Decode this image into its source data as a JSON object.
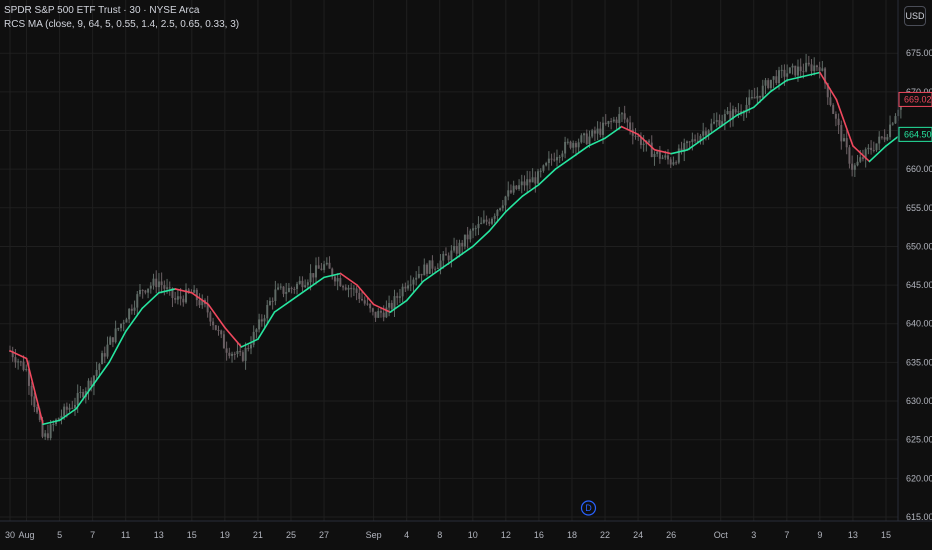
{
  "header": {
    "symbol_line": "SPDR S&P 500 ETF Trust · 30 · NYSE Arca",
    "indicator_line": "RCS MA (close, 9, 64, 5, 0.55, 1.4, 2.5, 0.65, 0.33, 3)"
  },
  "currency": "USD",
  "colors": {
    "background": "#0f0f0f",
    "grid": "#1f1f1f",
    "candle_up": "#5f6b66",
    "candle_down": "#6a5f63",
    "ma_up": "#26e6a0",
    "ma_down": "#f0485e",
    "price_badge_red": "#f0485e",
    "price_badge_green": "#26e6a0",
    "event_marker": "#2962ff"
  },
  "event_marker": {
    "label": "D",
    "date_index": 35
  },
  "chart_data": {
    "type": "line",
    "title": "",
    "xlabel": "",
    "ylabel": "",
    "ylim": [
      615,
      678
    ],
    "y_ticks": [
      615,
      620,
      625,
      630,
      635,
      640,
      645,
      650,
      655,
      660,
      665,
      670,
      675
    ],
    "y_tick_labels": [
      "615.00",
      "620.00",
      "625.00",
      "630.00",
      "635.00",
      "640.00",
      "645.00",
      "650.00",
      "655.00",
      "660.00",
      "665.00",
      "670.00",
      "675.00"
    ],
    "x_tick_labels": [
      {
        "label": "30",
        "i": 0
      },
      {
        "label": "Aug",
        "i": 1
      },
      {
        "label": "5",
        "i": 3
      },
      {
        "label": "7",
        "i": 5
      },
      {
        "label": "11",
        "i": 7
      },
      {
        "label": "13",
        "i": 9
      },
      {
        "label": "15",
        "i": 11
      },
      {
        "label": "19",
        "i": 13
      },
      {
        "label": "21",
        "i": 15
      },
      {
        "label": "25",
        "i": 17
      },
      {
        "label": "27",
        "i": 19
      },
      {
        "label": "Sep",
        "i": 22
      },
      {
        "label": "4",
        "i": 24
      },
      {
        "label": "8",
        "i": 26
      },
      {
        "label": "10",
        "i": 28
      },
      {
        "label": "12",
        "i": 30
      },
      {
        "label": "16",
        "i": 32
      },
      {
        "label": "18",
        "i": 34
      },
      {
        "label": "22",
        "i": 36
      },
      {
        "label": "24",
        "i": 38
      },
      {
        "label": "26",
        "i": 40
      },
      {
        "label": "Oct",
        "i": 43
      },
      {
        "label": "3",
        "i": 45
      },
      {
        "label": "7",
        "i": 47
      },
      {
        "label": "9",
        "i": 49
      },
      {
        "label": "13",
        "i": 51
      },
      {
        "label": "15",
        "i": 53
      }
    ],
    "x_count": 54,
    "series": [
      {
        "key": "price",
        "x": [
          0,
          1,
          2,
          3,
          4,
          5,
          6,
          7,
          8,
          9,
          10,
          11,
          12,
          13,
          14,
          15,
          16,
          17,
          18,
          19,
          20,
          21,
          22,
          23,
          24,
          25,
          26,
          27,
          28,
          29,
          30,
          31,
          32,
          33,
          34,
          35,
          36,
          37,
          38,
          39,
          40,
          41,
          42,
          43,
          44,
          45,
          46,
          47,
          48,
          49,
          50,
          51,
          52,
          53,
          53.9
        ],
        "values": [
          636.5,
          634.0,
          625.0,
          628.0,
          630.0,
          633.0,
          637.5,
          641.0,
          644.5,
          645.5,
          643.0,
          644.0,
          641.5,
          637.0,
          635.5,
          639.5,
          644.0,
          644.5,
          646.0,
          647.5,
          645.5,
          644.0,
          641.0,
          642.0,
          645.5,
          647.0,
          648.0,
          649.5,
          652.0,
          653.5,
          656.5,
          658.0,
          659.0,
          662.0,
          663.5,
          664.0,
          665.5,
          667.0,
          664.0,
          662.0,
          661.0,
          663.0,
          665.0,
          666.5,
          667.5,
          669.0,
          671.5,
          672.5,
          673.0,
          673.5,
          666.0,
          660.0,
          662.5,
          664.5,
          669.0
        ]
      },
      {
        "key": "ma",
        "x": [
          0,
          1,
          2,
          3,
          4,
          5,
          6,
          7,
          8,
          9,
          10,
          11,
          12,
          13,
          14,
          15,
          16,
          17,
          18,
          19,
          20,
          21,
          22,
          23,
          24,
          25,
          26,
          27,
          28,
          29,
          30,
          31,
          32,
          33,
          34,
          35,
          36,
          37,
          38,
          39,
          40,
          41,
          42,
          43,
          44,
          45,
          46,
          47,
          48,
          49,
          50,
          51,
          52,
          53,
          53.9
        ],
        "values": [
          636.5,
          635.5,
          627.0,
          627.5,
          629.0,
          632.0,
          635.0,
          639.0,
          642.0,
          644.0,
          644.5,
          644.0,
          642.5,
          639.5,
          637.0,
          638.0,
          641.5,
          643.0,
          644.5,
          646.0,
          646.5,
          645.0,
          642.5,
          641.5,
          643.0,
          645.5,
          647.0,
          648.5,
          650.0,
          652.0,
          654.5,
          656.5,
          658.0,
          660.0,
          661.5,
          663.0,
          664.0,
          665.5,
          664.5,
          662.5,
          662.0,
          662.5,
          664.0,
          665.5,
          667.0,
          668.0,
          670.0,
          671.5,
          672.0,
          672.5,
          669.0,
          663.0,
          661.0,
          663.0,
          664.5
        ]
      }
    ],
    "last_price_red": "669.02",
    "last_price_green": "664.50"
  }
}
